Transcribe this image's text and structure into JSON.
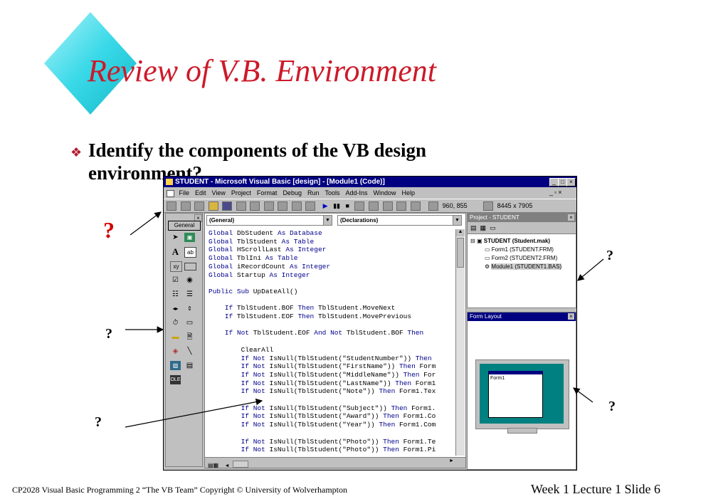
{
  "slide": {
    "title": "Review of V.B. Environment",
    "bullet_mark": "❖",
    "bullet": "Identify the components of the VB design environment?",
    "question_mark": "?",
    "footer_left": "CP2028 Visual Basic Programming 2    “The VB Team”   Copyright © University of Wolverhampton",
    "footer_right": "Week 1 Lecture 1 Slide 6",
    "colors": {
      "title": "#cc1a2a",
      "diamond": "#39d9e8",
      "question_red": "#d40000"
    }
  },
  "vb_window": {
    "title": "STUDENT - Microsoft Visual Basic [design] - [Module1 (Code)]",
    "window_buttons": [
      "_",
      "□",
      "×"
    ],
    "menu": [
      "File",
      "Edit",
      "View",
      "Project",
      "Format",
      "Debug",
      "Run",
      "Tools",
      "Add-Ins",
      "Window",
      "Help"
    ],
    "toolbar": {
      "position": "960, 855",
      "size": "8445 x 7905"
    },
    "toolbox": {
      "close": "×",
      "tab": "General"
    },
    "code": {
      "object_combo": "(General)",
      "proc_combo": "(Declarations)",
      "lines": [
        "Global DbStudent As Database",
        "Global TblStudent As Table",
        "Global HScrollLast As Integer",
        "Global TblIni As Table",
        "Global iRecordCount As Integer",
        "Global Startup As Integer",
        "",
        "Public Sub UpDateAll()",
        "",
        "    If TblStudent.BOF Then TblStudent.MoveNext",
        "    If TblStudent.EOF Then TblStudent.MovePrevious",
        "",
        "    If Not TblStudent.EOF And Not TblStudent.BOF Then",
        "",
        "        ClearAll",
        "        If Not IsNull(TblStudent(\"StudentNumber\")) Then",
        "        If Not IsNull(TblStudent(\"FirstName\")) Then Form",
        "        If Not IsNull(TblStudent(\"MiddleName\")) Then For",
        "        If Not IsNull(TblStudent(\"LastName\")) Then Form1",
        "        If Not IsNull(TblStudent(\"Note\")) Then Form1.Tex",
        "",
        "        If Not IsNull(TblStudent(\"Subject\")) Then Form1.",
        "        If Not IsNull(TblStudent(\"Award\")) Then Form1.Co",
        "        If Not IsNull(TblStudent(\"Year\")) Then Form1.Com",
        "",
        "        If Not IsNull(TblStudent(\"Photo\")) Then Form1.Te",
        "        If Not IsNull(TblStudent(\"Photo\")) Then Form1.Pi"
      ]
    },
    "project": {
      "title": "Project - STUDENT",
      "close": "×",
      "root": "STUDENT (Student.mak)",
      "items": [
        "Form1 (STUDENT.FRM)",
        "Form2 (STUDENT2.FRM)",
        "Module1 (STUDENT1.BAS)"
      ]
    },
    "form_layout": {
      "title": "Form Layout",
      "close": "×",
      "form_label": "Form1"
    }
  }
}
